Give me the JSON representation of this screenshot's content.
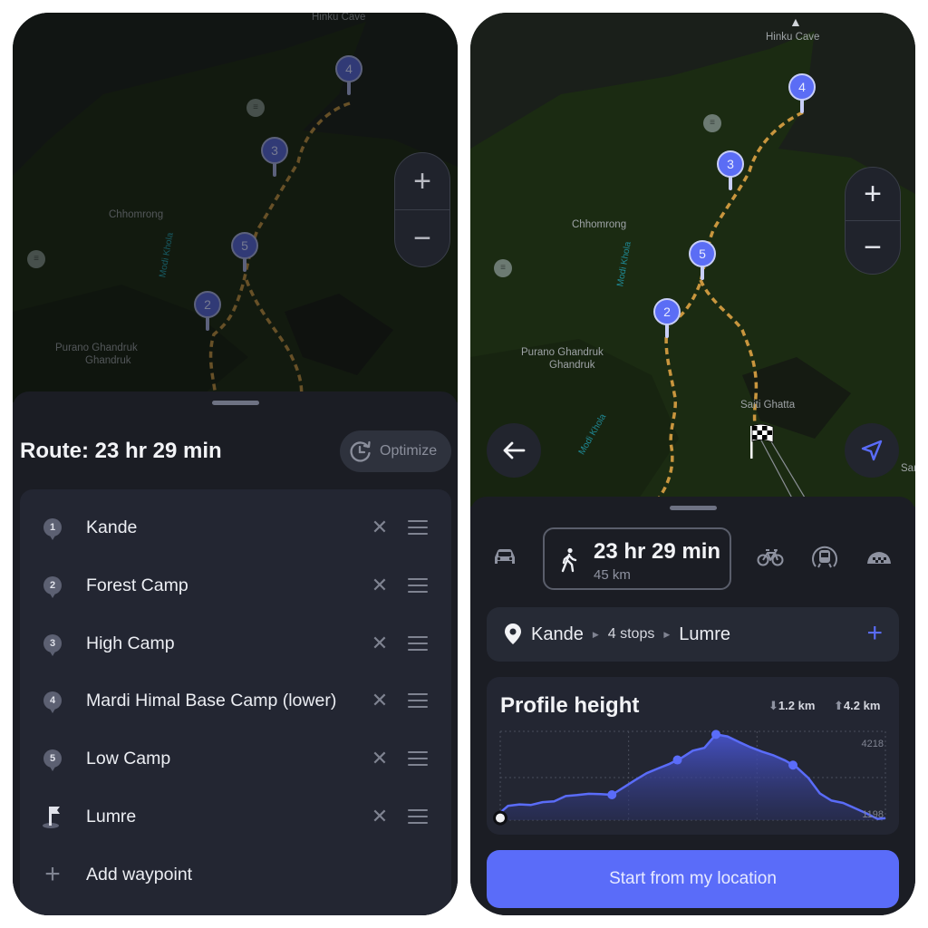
{
  "left_screen": {
    "map": {
      "labels": {
        "hinku_cave": "Hinku Cave",
        "chhomrong": "Chhomrong",
        "modi_khola": "Modi Khola",
        "purano_ghandruk": "Purano Ghandruk",
        "ghandruk": "Ghandruk"
      },
      "pins": [
        "4",
        "3",
        "5",
        "2"
      ],
      "zoom_in_label": "+",
      "zoom_out_label": "−"
    },
    "route_title": "Route: 23 hr 29 min",
    "optimize_label": "Optimize",
    "waypoints": [
      {
        "badge": "1",
        "name": "Kande",
        "icon": "numbered-pin"
      },
      {
        "badge": "2",
        "name": "Forest Camp",
        "icon": "numbered-pin"
      },
      {
        "badge": "3",
        "name": "High Camp",
        "icon": "numbered-pin"
      },
      {
        "badge": "4",
        "name": "Mardi Himal Base Camp (lower)",
        "icon": "numbered-pin"
      },
      {
        "badge": "5",
        "name": "Low Camp",
        "icon": "numbered-pin"
      },
      {
        "badge": "",
        "name": "Lumre",
        "icon": "finish-flag"
      }
    ],
    "remove_glyph": "✕",
    "add_waypoint_label": "Add waypoint"
  },
  "right_screen": {
    "map": {
      "labels": {
        "hinku_cave": "Hinku Cave",
        "chhomrong": "Chhomrong",
        "modi_khola": "Modi Khola",
        "modi_khola_2": "Modi Khola",
        "purano_ghandruk": "Purano Ghandruk",
        "ghandruk": "Ghandruk",
        "saiti_ghatta": "Saiti Ghatta",
        "sar": "Sar"
      },
      "pins": [
        "4",
        "3",
        "5",
        "2"
      ],
      "zoom_in_label": "+",
      "zoom_out_label": "−"
    },
    "transport_modes": [
      {
        "name": "car",
        "icon": "car-icon"
      },
      {
        "name": "walk",
        "icon": "walk-icon",
        "selected": true,
        "duration": "23 hr 29 min",
        "distance": "45 km"
      },
      {
        "name": "bike",
        "icon": "bicycle-icon"
      },
      {
        "name": "transit",
        "icon": "train-icon"
      },
      {
        "name": "taxi",
        "icon": "taxi-icon"
      }
    ],
    "stops": {
      "start": "Kande",
      "middle": "4 stops",
      "end": "Lumre",
      "separator": "▶",
      "add_label": "+"
    },
    "profile": {
      "title": "Profile height",
      "descent": "1.2 km",
      "ascent": "4.2 km"
    },
    "start_button_label": "Start from my location",
    "accent_color": "#5a6cf9"
  },
  "chart_data": {
    "type": "area",
    "title": "Profile height",
    "xlabel": "",
    "ylabel": "",
    "y_tick_labels": [
      "4218",
      "1198"
    ],
    "ylim": [
      1000,
      4500
    ],
    "x": [
      0,
      0.02,
      0.05,
      0.08,
      0.11,
      0.14,
      0.17,
      0.2,
      0.23,
      0.26,
      0.29,
      0.32,
      0.35,
      0.38,
      0.41,
      0.44,
      0.47,
      0.5,
      0.53,
      0.56,
      0.59,
      0.62,
      0.65,
      0.68,
      0.71,
      0.74,
      0.77,
      0.8,
      0.83,
      0.86,
      0.89,
      0.92,
      0.95,
      0.98,
      1.0
    ],
    "values": [
      1300,
      1560,
      1620,
      1600,
      1710,
      1740,
      1950,
      1990,
      2040,
      2030,
      2000,
      2290,
      2580,
      2850,
      3040,
      3220,
      3450,
      3740,
      3850,
      4380,
      4300,
      4080,
      3870,
      3700,
      3550,
      3350,
      3080,
      2660,
      2050,
      1770,
      1680,
      1480,
      1270,
      1050,
      1080
    ],
    "waypoint_markers_x": [
      0.29,
      0.46,
      0.56,
      0.76
    ],
    "grid": true,
    "legend": "none"
  }
}
